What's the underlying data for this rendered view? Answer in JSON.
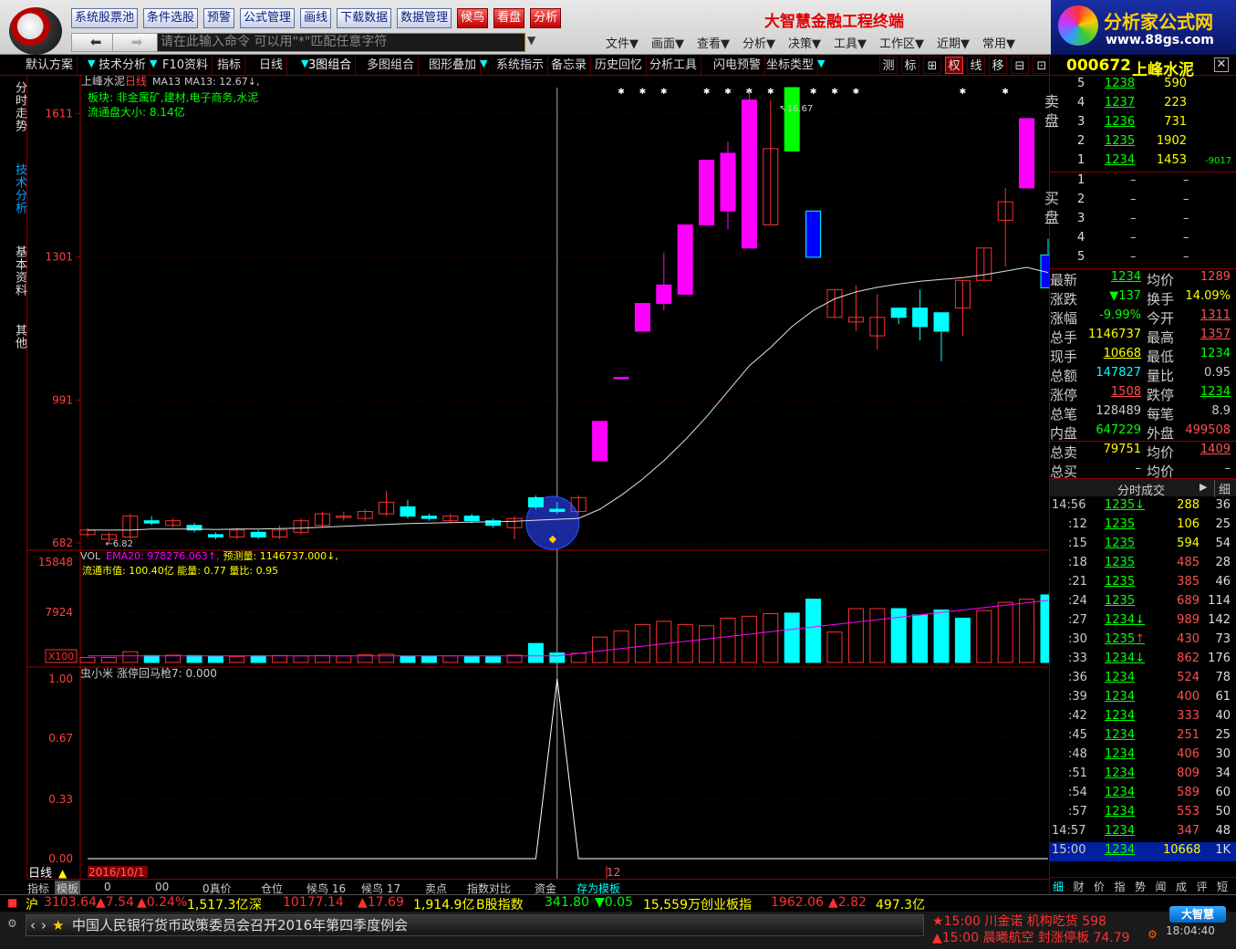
{
  "toolbar": {
    "buttons": [
      "系统股票池",
      "条件选股",
      "预警",
      "公式管理",
      "画线",
      "下载数据",
      "数据管理"
    ],
    "red_buttons": [
      "候鸟",
      "看盘",
      "分析"
    ],
    "title": "大智慧金融工程终端"
  },
  "brand": {
    "name": "分析家公式网",
    "url": "www.88gs.com"
  },
  "nav": {
    "back_icon": "back-arrow-icon",
    "forward_icon": "forward-arrow-icon",
    "command_placeholder": "请在此输入命令   可以用\"*\"匹配任意字符",
    "menus": [
      "文件▼",
      "画面▼",
      "查看▼",
      "分析▼",
      "决策▼",
      "工具▼",
      "工作区▼",
      "近期▼",
      "常用▼"
    ]
  },
  "tabs": [
    "默认方案",
    "技术分析",
    "F10资料",
    "指标",
    "日线",
    "3图组合",
    "多图组合",
    "图形叠加",
    "系统指示",
    "备忘录",
    "历史回忆",
    "分析工具",
    "闪电预警",
    "坐标类型"
  ],
  "right_tools": [
    "测",
    "标",
    "⊞",
    "权",
    "线",
    "移",
    "⊟",
    "⊡"
  ],
  "left_tabs": [
    "分时走势",
    "技术分析",
    "基本资料",
    "其他"
  ],
  "chart": {
    "title": "上峰水泥",
    "period": "日线",
    "ma_label": "MA13",
    "ma_value": "MA13: 12.67↓,",
    "sector": "板块: 非金属矿,建材,电子商务,水泥",
    "float_cap": "流通盘大小: 8.14亿",
    "y_ticks": [
      "1611",
      "1301",
      "991",
      "682"
    ],
    "low_marker": "6.82",
    "high_marker": "16.67",
    "vol_title": "VOL",
    "vol_ema": "EMA20: 978276.063↑,",
    "vol_forecast": "预测量: 1146737.000↓,",
    "vol_line2": "流通市值: 100.40亿  能量: 0.77  量比: 0.95",
    "vol_ticks": [
      "15848",
      "7924",
      "X100"
    ],
    "ind_title": "虫小米",
    "ind_label": "涨停回马枪7: 0.000",
    "ind_ticks": [
      "1.00",
      "0.67",
      "0.33",
      "0.00"
    ],
    "date_left": "2016/10/1",
    "date_mid": "12",
    "period_label": "日线"
  },
  "chart_data": {
    "type": "candlestick",
    "candles": [
      [
        7.0,
        7.1,
        6.95,
        7.15
      ],
      [
        6.9,
        7.0,
        6.82,
        7.05
      ],
      [
        6.95,
        7.4,
        6.9,
        7.45
      ],
      [
        7.3,
        7.25,
        7.2,
        7.4
      ],
      [
        7.2,
        7.3,
        7.15,
        7.35
      ],
      [
        7.2,
        7.1,
        7.05,
        7.25
      ],
      [
        7.0,
        6.95,
        6.9,
        7.05
      ],
      [
        6.95,
        7.1,
        6.9,
        7.15
      ],
      [
        7.05,
        6.95,
        6.9,
        7.1
      ],
      [
        6.95,
        7.1,
        6.9,
        7.2
      ],
      [
        7.05,
        7.3,
        7.0,
        7.35
      ],
      [
        7.2,
        7.45,
        7.15,
        7.5
      ],
      [
        7.4,
        7.4,
        7.3,
        7.5
      ],
      [
        7.35,
        7.5,
        7.3,
        7.55
      ],
      [
        7.45,
        7.7,
        7.4,
        7.95
      ],
      [
        7.6,
        7.4,
        7.35,
        7.75
      ],
      [
        7.4,
        7.35,
        7.3,
        7.45
      ],
      [
        7.3,
        7.4,
        7.25,
        7.45
      ],
      [
        7.4,
        7.3,
        7.25,
        7.45
      ],
      [
        7.3,
        7.2,
        7.15,
        7.35
      ],
      [
        7.15,
        7.35,
        6.9,
        7.4
      ],
      [
        7.8,
        7.6,
        7.55,
        7.85
      ],
      [
        7.55,
        7.5,
        7.45,
        7.7
      ],
      [
        7.5,
        7.8,
        7.45,
        7.85
      ],
      [
        8.6,
        9.45,
        8.6,
        9.45
      ],
      [
        10.4,
        10.4,
        10.4,
        10.4
      ],
      [
        11.4,
        12.0,
        11.4,
        12.0
      ],
      [
        12.0,
        12.4,
        11.85,
        13.1
      ],
      [
        12.2,
        13.7,
        12.2,
        13.7
      ],
      [
        13.7,
        15.1,
        13.7,
        15.1
      ],
      [
        14.0,
        15.25,
        13.6,
        15.5
      ],
      [
        13.2,
        16.4,
        13.2,
        16.6
      ],
      [
        13.7,
        15.35,
        13.7,
        16.4
      ],
      [
        15.3,
        16.67,
        15.3,
        16.67
      ],
      [
        13.0,
        14.0,
        13.0,
        14.0
      ],
      [
        11.7,
        12.3,
        11.7,
        12.3
      ],
      [
        11.6,
        11.7,
        11.4,
        12.4
      ],
      [
        11.3,
        11.7,
        11.0,
        12.2
      ],
      [
        11.9,
        11.7,
        11.55,
        11.9
      ],
      [
        11.9,
        11.5,
        11.2,
        12.3
      ],
      [
        11.8,
        11.4,
        10.75,
        11.7
      ],
      [
        11.9,
        12.5,
        11.3,
        12.5
      ],
      [
        12.5,
        13.2,
        12.5,
        13.2
      ],
      [
        13.8,
        14.2,
        12.8,
        14.5
      ],
      [
        14.5,
        16.0,
        14.5,
        16.0
      ],
      [
        12.34,
        13.05,
        12.34,
        13.4
      ]
    ],
    "ma13": [
      7.1,
      7.1,
      7.1,
      7.12,
      7.12,
      7.12,
      7.11,
      7.12,
      7.12,
      7.13,
      7.14,
      7.16,
      7.18,
      7.2,
      7.22,
      7.24,
      7.25,
      7.26,
      7.27,
      7.28,
      7.29,
      7.31,
      7.33,
      7.35,
      7.55,
      7.85,
      8.2,
      8.6,
      9.05,
      9.55,
      10.1,
      10.65,
      11.05,
      11.5,
      11.85,
      12.1,
      12.25,
      12.35,
      12.42,
      12.48,
      12.52,
      12.56,
      12.62,
      12.7,
      12.78,
      12.67
    ],
    "volume": [
      800,
      800,
      1700,
      1100,
      1150,
      1100,
      950,
      950,
      1050,
      1100,
      1050,
      1100,
      1050,
      1200,
      1300,
      1000,
      950,
      1050,
      900,
      900,
      1150,
      3000,
      1500,
      1450,
      4000,
      5000,
      6000,
      6500,
      6000,
      5800,
      7000,
      7300,
      7700,
      7800,
      10000,
      4800,
      8500,
      8500,
      8500,
      7500,
      8300,
      7000,
      8200,
      9500,
      10000,
      10668
    ],
    "indicator": {
      "name": "涨停回马枪7",
      "peak_index": 22,
      "peak_value": 1.0
    },
    "y_range": [
      6.82,
      16.67
    ],
    "y_ticks": [
      16.11,
      13.01,
      9.91,
      6.82
    ],
    "vol_range": [
      0,
      15848
    ]
  },
  "quote": {
    "code": "000672",
    "name": "上峰水泥",
    "sell_label": "卖 盘",
    "buy_label": "买 盘",
    "sells": [
      [
        "5",
        "1238",
        "590",
        ""
      ],
      [
        "4",
        "1237",
        "223",
        ""
      ],
      [
        "3",
        "1236",
        "731",
        ""
      ],
      [
        "2",
        "1235",
        "1902",
        ""
      ],
      [
        "1",
        "1234",
        "1453",
        "-9017"
      ]
    ],
    "buys": [
      [
        "1",
        "–",
        "–"
      ],
      [
        "2",
        "–",
        "–"
      ],
      [
        "3",
        "–",
        "–"
      ],
      [
        "4",
        "–",
        "–"
      ],
      [
        "5",
        "–",
        "–"
      ]
    ],
    "stats": [
      [
        "最新",
        "1234",
        "均价",
        "1289"
      ],
      [
        "涨跌",
        "▼137",
        "换手",
        "14.09%"
      ],
      [
        "涨幅",
        "-9.99%",
        "今开",
        "1311"
      ],
      [
        "总手",
        "1146737",
        "最高",
        "1357"
      ],
      [
        "现手",
        "10668",
        "最低",
        "1234"
      ],
      [
        "总额",
        "147827",
        "量比",
        "0.95"
      ],
      [
        "涨停",
        "1508",
        "跌停",
        "1234"
      ],
      [
        "总笔",
        "128489",
        "每笔",
        "8.9"
      ],
      [
        "内盘",
        "647229",
        "外盘",
        "499508"
      ],
      [
        "总卖",
        "79751",
        "均价",
        "1409"
      ],
      [
        "总买",
        "–",
        "均价",
        "–"
      ]
    ],
    "ticks_title": "分时成交",
    "ticks_btn": "细",
    "ticks": [
      [
        "14:56",
        "1235↓",
        "288",
        "36"
      ],
      [
        ":12",
        "1235",
        "106",
        "25"
      ],
      [
        ":15",
        "1235",
        "594",
        "54"
      ],
      [
        ":18",
        "1235",
        "485",
        "28"
      ],
      [
        ":21",
        "1235",
        "385",
        "46"
      ],
      [
        ":24",
        "1235",
        "689",
        "114"
      ],
      [
        ":27",
        "1234↓",
        "989",
        "142"
      ],
      [
        ":30",
        "1235↑",
        "430",
        "73"
      ],
      [
        ":33",
        "1234↓",
        "862",
        "176"
      ],
      [
        ":36",
        "1234",
        "524",
        "78"
      ],
      [
        ":39",
        "1234",
        "400",
        "61"
      ],
      [
        ":42",
        "1234",
        "333",
        "40"
      ],
      [
        ":45",
        "1234",
        "251",
        "25"
      ],
      [
        ":48",
        "1234",
        "406",
        "30"
      ],
      [
        ":51",
        "1234",
        "809",
        "34"
      ],
      [
        ":54",
        "1234",
        "589",
        "60"
      ],
      [
        ":57",
        "1234",
        "553",
        "50"
      ],
      [
        "14:57",
        "1234",
        "347",
        "48"
      ],
      [
        "15:00",
        "1234",
        "10668",
        "1K"
      ]
    ],
    "bottom_tabs": [
      "细",
      "财",
      "价",
      "指",
      "势",
      "闻",
      "成",
      "评",
      "短"
    ]
  },
  "bottom_tabs": [
    "指标",
    "模板",
    "0",
    "00",
    "0真价",
    "仓位",
    "候鸟 16",
    "候鸟 17",
    "卖点",
    "指数对比",
    "资金",
    "存为模板"
  ],
  "status": {
    "sh_label": "沪",
    "sh_value": "3103.64",
    "sh_change": "▲7.54",
    "sh_pct": "▲0.24%",
    "sh_amount": "1,517.3亿",
    "sz_label": "深",
    "sz_value": "10177.14",
    "sz_change": "▲17.69",
    "sz_amount": "1,914.9亿",
    "b_label": "B股指数",
    "b_value": "341.80",
    "b_change": "▼0.05",
    "b_amount": "15,559万",
    "cy_label": "创业板指",
    "cy_value": "1962.06",
    "cy_change": "▲2.82",
    "cy_amount": "497.3亿",
    "news": "中国人民银行货币政策委员会召开2016年第四季度例会",
    "alert1": "★15:00  川金诺 机构吃货 598",
    "alert2": "▲15:00 晨曦航空 封涨停板 74.79",
    "brand_small": "大智慧",
    "clock": "18:04:40"
  }
}
